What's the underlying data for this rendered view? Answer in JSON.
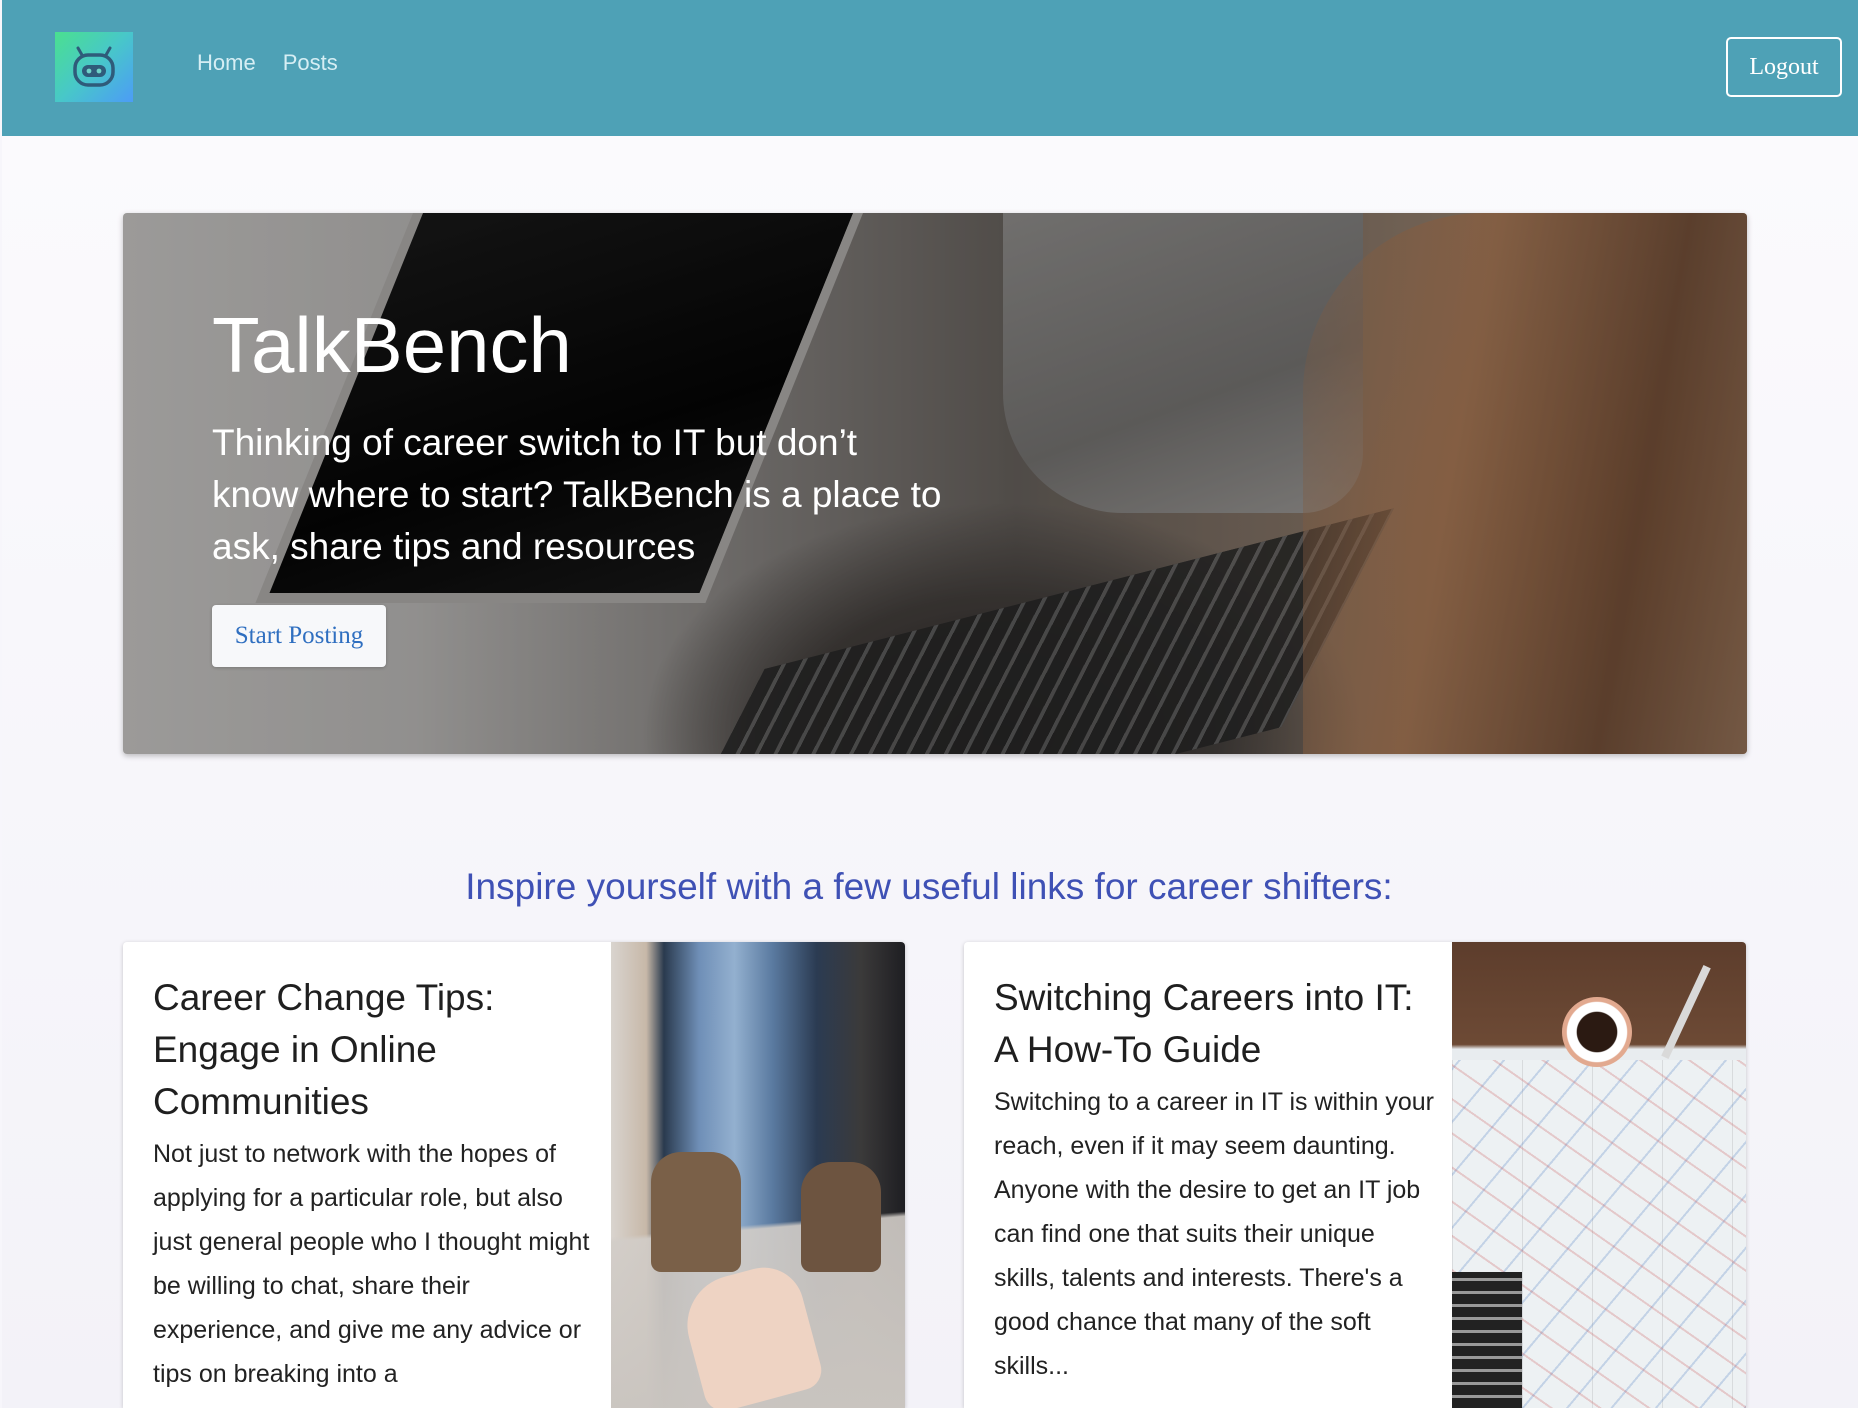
{
  "app": {
    "logo_icon": "robot-icon"
  },
  "nav": {
    "links": [
      "Home",
      "Posts"
    ],
    "logout_label": "Logout"
  },
  "hero": {
    "title": "TalkBench",
    "text": "Thinking of career switch to IT but don’t know where to start? TalkBench is a place to ask, share tips and resources",
    "button_label": "Start Posting"
  },
  "section": {
    "heading": "Inspire yourself with a few useful links for career shifters:"
  },
  "cards": [
    {
      "title": "Career Change Tips: Engage in Online Communities",
      "text": "Not just to network with the hopes of applying for a particular role, but also just general people who I thought might be willing to chat, share their experience, and give me any advice or tips on breaking into a"
    },
    {
      "title": "Switching Careers into IT: A How-To Guide",
      "text": "Switching to a career in IT is within your reach, even if it may seem daunting. Anyone with the desire to get an IT job can find one that suits their unique skills, talents and interests. There's a good chance that many of the soft skills..."
    }
  ],
  "colors": {
    "navbar": "#4ea1b6",
    "heading": "#3f51b5",
    "button_text": "#2f6fc0"
  }
}
